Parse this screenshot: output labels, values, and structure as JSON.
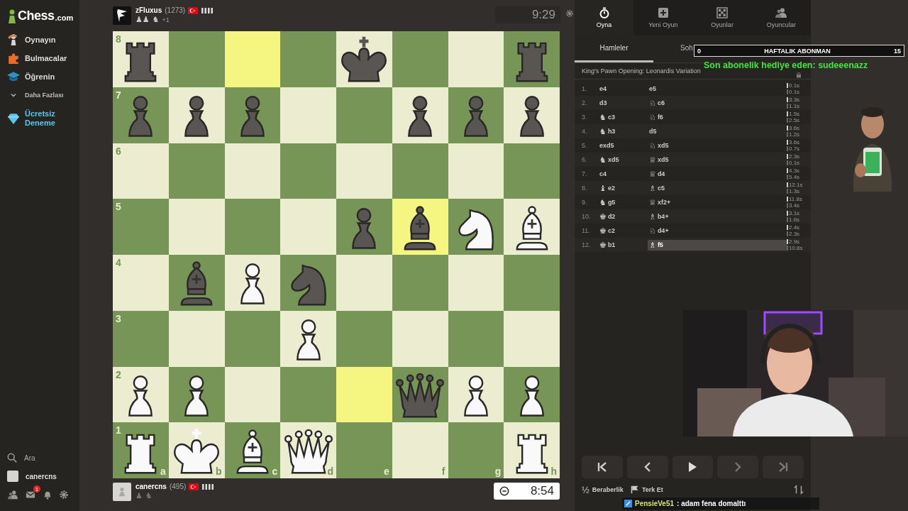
{
  "sidebar": {
    "logo": {
      "name": "Chess",
      "suffix": ".com"
    },
    "items": [
      {
        "kind": "nav",
        "label": "Oynayın"
      },
      {
        "kind": "nav",
        "label": "Bulmacalar"
      },
      {
        "kind": "nav",
        "label": "Öğrenin"
      },
      {
        "kind": "more",
        "label": "Daha Fazlası"
      },
      {
        "kind": "promo",
        "label": "Ücretsiz Deneme"
      }
    ],
    "search": "Ara",
    "user": "canercns",
    "mail_badge": "1"
  },
  "top_player": {
    "name": "zFluxus",
    "rating": "(1273)",
    "captured": [
      "♟♟",
      "♞"
    ],
    "advantage": "+1"
  },
  "top_clock": {
    "time": "9:29",
    "active": false
  },
  "board": {
    "ranks": [
      {
        "label": "8",
        "squares": [
          {
            "kind": "rook",
            "color": "#585553",
            "highlighted": false
          },
          {
            "highlighted": false
          },
          {
            "highlighted": true
          },
          {
            "highlighted": false
          },
          {
            "kind": "king",
            "color": "#585553",
            "highlighted": false
          },
          {
            "highlighted": false
          },
          {
            "highlighted": false
          },
          {
            "kind": "rook",
            "color": "#585553",
            "highlighted": false
          }
        ]
      },
      {
        "label": "7",
        "squares": [
          {
            "kind": "pawn",
            "color": "#585553",
            "highlighted": false
          },
          {
            "kind": "pawn",
            "color": "#585553",
            "highlighted": false
          },
          {
            "kind": "pawn",
            "color": "#585553",
            "highlighted": false
          },
          {
            "highlighted": false
          },
          {
            "highlighted": false
          },
          {
            "kind": "pawn",
            "color": "#585553",
            "highlighted": false
          },
          {
            "kind": "pawn",
            "color": "#585553",
            "highlighted": false
          },
          {
            "kind": "pawn",
            "color": "#585553",
            "highlighted": false
          }
        ]
      },
      {
        "label": "6",
        "squares": [
          {
            "highlighted": false
          },
          {
            "highlighted": false
          },
          {
            "highlighted": false
          },
          {
            "highlighted": false
          },
          {
            "highlighted": false
          },
          {
            "highlighted": false
          },
          {
            "highlighted": false
          },
          {
            "highlighted": false
          }
        ]
      },
      {
        "label": "5",
        "squares": [
          {
            "highlighted": false
          },
          {
            "highlighted": false
          },
          {
            "highlighted": false
          },
          {
            "highlighted": false
          },
          {
            "kind": "pawn",
            "color": "#585553",
            "highlighted": false
          },
          {
            "kind": "bishop",
            "color": "#585553",
            "highlighted": true
          },
          {
            "kind": "knight",
            "color": "#f9f9f9",
            "highlighted": false
          },
          {
            "kind": "bishop",
            "color": "#f9f9f9",
            "highlighted": false
          }
        ]
      },
      {
        "label": "4",
        "squares": [
          {
            "highlighted": false
          },
          {
            "kind": "bishop",
            "color": "#585553",
            "highlighted": false
          },
          {
            "kind": "pawn",
            "color": "#f9f9f9",
            "highlighted": false
          },
          {
            "kind": "knight",
            "color": "#585553",
            "highlighted": false
          },
          {
            "highlighted": false
          },
          {
            "highlighted": false
          },
          {
            "highlighted": false
          },
          {
            "highlighted": false
          }
        ]
      },
      {
        "label": "3",
        "squares": [
          {
            "highlighted": false
          },
          {
            "highlighted": false
          },
          {
            "highlighted": false
          },
          {
            "kind": "pawn",
            "color": "#f9f9f9",
            "highlighted": false
          },
          {
            "highlighted": false
          },
          {
            "highlighted": false
          },
          {
            "highlighted": false
          },
          {
            "highlighted": false
          }
        ]
      },
      {
        "label": "2",
        "squares": [
          {
            "kind": "pawn",
            "color": "#f9f9f9",
            "highlighted": false
          },
          {
            "kind": "pawn",
            "color": "#f9f9f9",
            "highlighted": false
          },
          {
            "highlighted": false
          },
          {
            "highlighted": false
          },
          {
            "highlighted": true
          },
          {
            "kind": "queen",
            "color": "#585553",
            "highlighted": false
          },
          {
            "kind": "pawn",
            "color": "#f9f9f9",
            "highlighted": false
          },
          {
            "kind": "pawn",
            "color": "#f9f9f9",
            "highlighted": false
          }
        ]
      },
      {
        "label": "1",
        "squares": [
          {
            "kind": "rook",
            "color": "#f9f9f9",
            "highlighted": false
          },
          {
            "kind": "king",
            "color": "#f9f9f9",
            "highlighted": false
          },
          {
            "kind": "bishop",
            "color": "#f9f9f9",
            "highlighted": false
          },
          {
            "kind": "queen",
            "color": "#f9f9f9",
            "highlighted": false
          },
          {
            "highlighted": false
          },
          {
            "highlighted": false
          },
          {
            "highlighted": false
          },
          {
            "kind": "rook",
            "color": "#f9f9f9",
            "highlighted": false
          }
        ]
      }
    ],
    "files": [
      "a",
      "b",
      "c",
      "d",
      "e",
      "f",
      "g",
      "h"
    ]
  },
  "bottom_player": {
    "name": "canercns",
    "rating": "(495)",
    "captured": [
      "♟",
      "♞"
    ]
  },
  "bottom_clock": {
    "time": "8:54",
    "active": true
  },
  "panel": {
    "tabs": [
      {
        "label": "Oyna",
        "selected": true
      },
      {
        "label": "Yeni Oyun",
        "selected": false
      },
      {
        "label": "Oyunlar",
        "selected": false
      },
      {
        "label": "Oyuncular",
        "selected": false
      }
    ],
    "subtabs": [
      {
        "label": "Hamleler",
        "selected": true
      },
      {
        "label": "Soh",
        "selected": false
      }
    ],
    "opening": "King's Pawn Opening: Leonardis Variation",
    "moves": [
      {
        "number": "1.",
        "white": {
          "san": "e4",
          "selected": false
        },
        "black": {
          "san": "e5",
          "selected": false
        },
        "times": [
          "0.1s",
          "0.1s"
        ]
      },
      {
        "number": "2.",
        "white": {
          "san": "d3",
          "selected": false
        },
        "black": {
          "piece": "♘",
          "san": "c6",
          "selected": false
        },
        "times": [
          "3.3s",
          "1.1s"
        ]
      },
      {
        "number": "3.",
        "white": {
          "piece": "♞",
          "san": "c3",
          "selected": false
        },
        "black": {
          "piece": "♘",
          "san": "f6",
          "selected": false
        },
        "times": [
          "1.5s",
          "2.5s"
        ]
      },
      {
        "number": "4.",
        "white": {
          "piece": "♞",
          "san": "h3",
          "selected": false
        },
        "black": {
          "san": "d5",
          "selected": false
        },
        "times": [
          "3.6s",
          "1.2s"
        ]
      },
      {
        "number": "5.",
        "white": {
          "san": "exd5",
          "selected": false
        },
        "black": {
          "piece": "♘",
          "san": "xd5",
          "selected": false
        },
        "times": [
          "3.6s",
          "0.7s"
        ]
      },
      {
        "number": "6.",
        "white": {
          "piece": "♞",
          "san": "xd5",
          "selected": false
        },
        "black": {
          "piece": "♕",
          "san": "xd5",
          "selected": false
        },
        "times": [
          "2.3s",
          "0.1s"
        ]
      },
      {
        "number": "7.",
        "white": {
          "san": "c4",
          "selected": false
        },
        "black": {
          "piece": "♕",
          "san": "d4",
          "selected": false
        },
        "times": [
          "4.3s",
          "5.4s"
        ]
      },
      {
        "number": "8.",
        "white": {
          "piece": "♝",
          "san": "e2",
          "selected": false
        },
        "black": {
          "piece": "♗",
          "san": "c5",
          "selected": false
        },
        "times": [
          "12.1s",
          "1.3s"
        ]
      },
      {
        "number": "9.",
        "white": {
          "piece": "♞",
          "san": "g5",
          "selected": false
        },
        "black": {
          "piece": "♕",
          "san": "xf2+",
          "selected": false
        },
        "times": [
          "11.8s",
          "3.4s"
        ]
      },
      {
        "number": "10.",
        "white": {
          "piece": "♚",
          "san": "d2",
          "selected": false
        },
        "black": {
          "piece": "♗",
          "san": "b4+",
          "selected": false
        },
        "times": [
          "3.1s",
          "1.6s"
        ]
      },
      {
        "number": "11.",
        "white": {
          "piece": "♚",
          "san": "c2",
          "selected": false
        },
        "black": {
          "piece": "♘",
          "san": "d4+",
          "selected": false
        },
        "times": [
          "2.4s",
          "2.3s"
        ]
      },
      {
        "number": "12.",
        "white": {
          "piece": "♚",
          "san": "b1",
          "selected": false
        },
        "black": {
          "piece": "♗",
          "san": "f5",
          "selected": true
        },
        "times": [
          "2.9s",
          "10.8s"
        ]
      }
    ],
    "actions": [
      {
        "kind": "draw",
        "symbol": "½",
        "label": "Beraberlik"
      },
      {
        "kind": "resign",
        "label": "Terk Et"
      }
    ]
  },
  "overlay": {
    "goal": {
      "current": "0",
      "title": "HAFTALIK ABONMAN",
      "target": "15"
    },
    "last_gift": "Son abonelik hediye eden: sudeeenazz",
    "chat": {
      "user": "PensieVe51",
      "message": ": adam fena domalttı"
    }
  }
}
